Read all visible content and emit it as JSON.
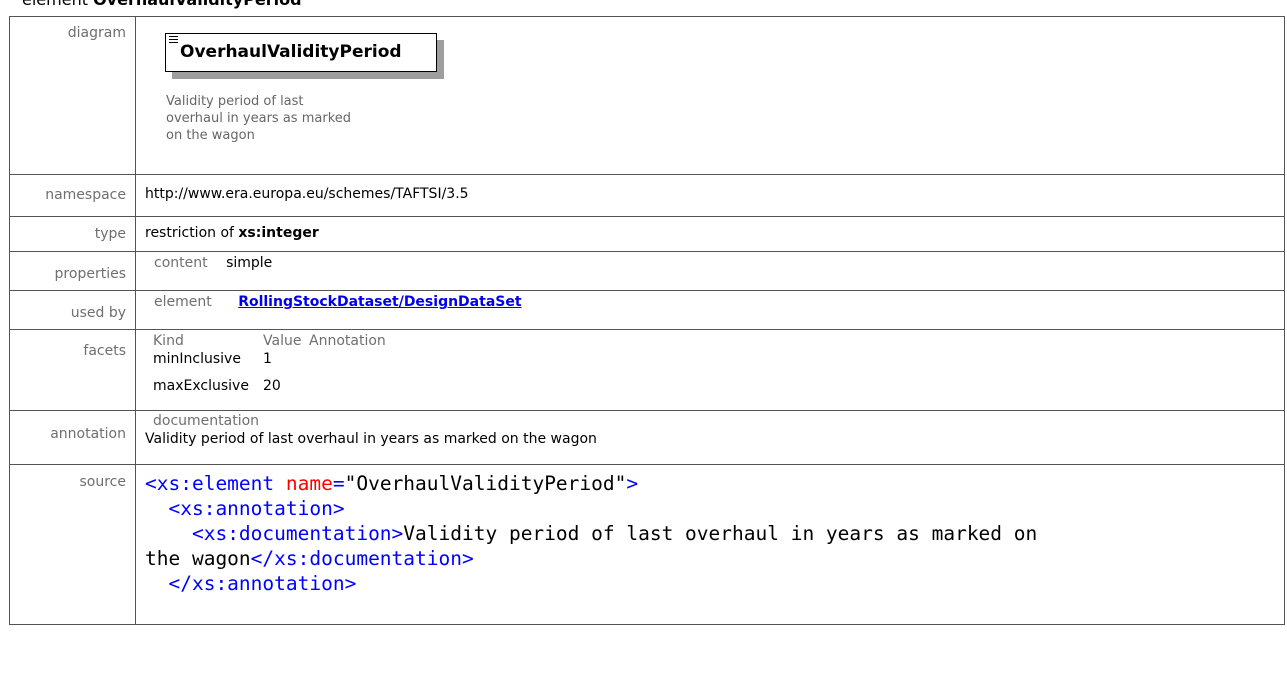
{
  "heading": {
    "prefix": "element",
    "name": "OverhaulValidityPeriod"
  },
  "rows": {
    "diagram": {
      "label": "diagram",
      "element_name": "OverhaulValidityPeriod",
      "doc": "Validity period of last overhaul in years as marked on the wagon"
    },
    "namespace": {
      "label": "namespace",
      "value": "http://www.era.europa.eu/schemes/TAFTSI/3.5"
    },
    "type": {
      "label": "type",
      "prefix": "restriction of",
      "value": "xs:integer"
    },
    "properties": {
      "label": "properties",
      "key": "content",
      "value": "simple"
    },
    "used_by": {
      "label": "used by",
      "key": "element",
      "link": "RollingStockDataset/DesignDataSet"
    },
    "facets": {
      "label": "facets",
      "headers": [
        "Kind",
        "Value",
        "Annotation"
      ],
      "items": [
        {
          "kind": "minInclusive",
          "value": "1"
        },
        {
          "kind": "maxExclusive",
          "value": "20"
        }
      ]
    },
    "annotation": {
      "label": "annotation",
      "key": "documentation",
      "text": "Validity period of last overhaul in years as marked on the wagon"
    },
    "source": {
      "label": "source",
      "l1_open": "<xs:element",
      "l1_attr": "name",
      "l1_eq": "=",
      "l1_val": "\"OverhaulValidityPeriod\"",
      "l1_close": ">",
      "l2": "<xs:annotation>",
      "l3_open": "<xs:documentation>",
      "l3_text": "Validity period of last overhaul in years as marked on",
      "l4_text": "the wagon",
      "l4_close": "</xs:documentation>",
      "l5": "</xs:annotation>"
    }
  }
}
